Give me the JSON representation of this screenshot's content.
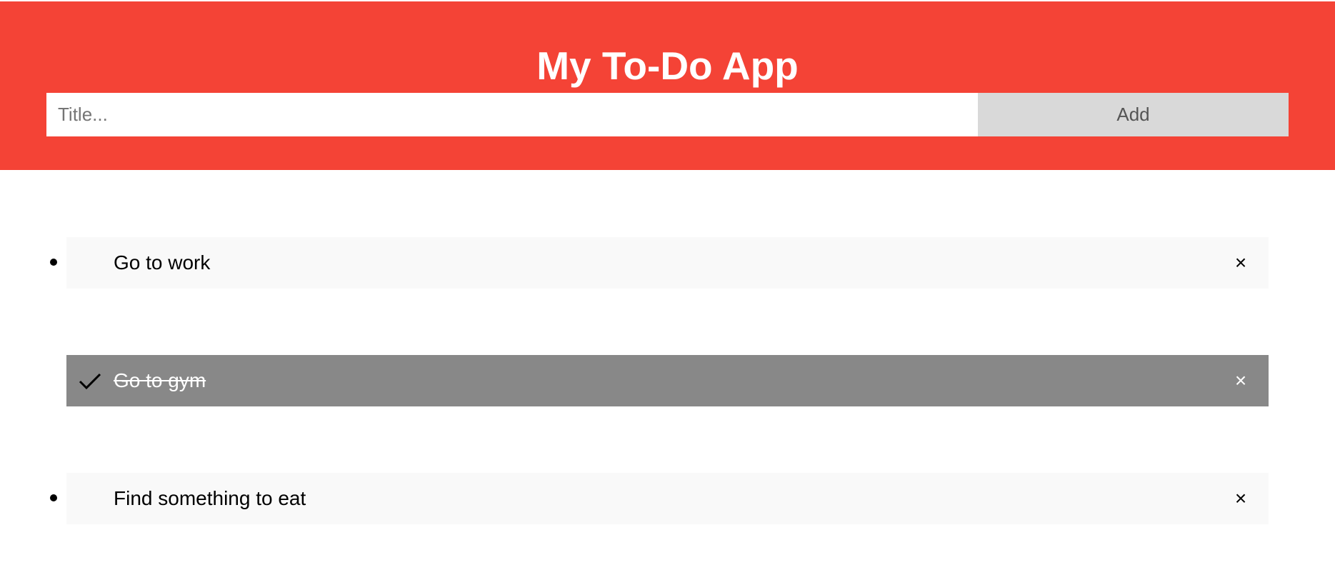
{
  "header": {
    "title": "My To-Do App",
    "background_color": "#f44336"
  },
  "add_form": {
    "input_value": "",
    "input_placeholder": "Title...",
    "add_label": "Add"
  },
  "todos": [
    {
      "text": "Go to work",
      "checked": false,
      "close_symbol": "×"
    },
    {
      "text": "Go to gym",
      "checked": true,
      "close_symbol": "×"
    },
    {
      "text": "Find something to eat",
      "checked": false,
      "close_symbol": "×"
    }
  ],
  "icons": {
    "checked_item": "check-icon",
    "remove_item": "close-icon"
  },
  "colors": {
    "checked_background": "#888888",
    "item_background": "#f9f9f9",
    "button_background": "#d9d9d9"
  }
}
